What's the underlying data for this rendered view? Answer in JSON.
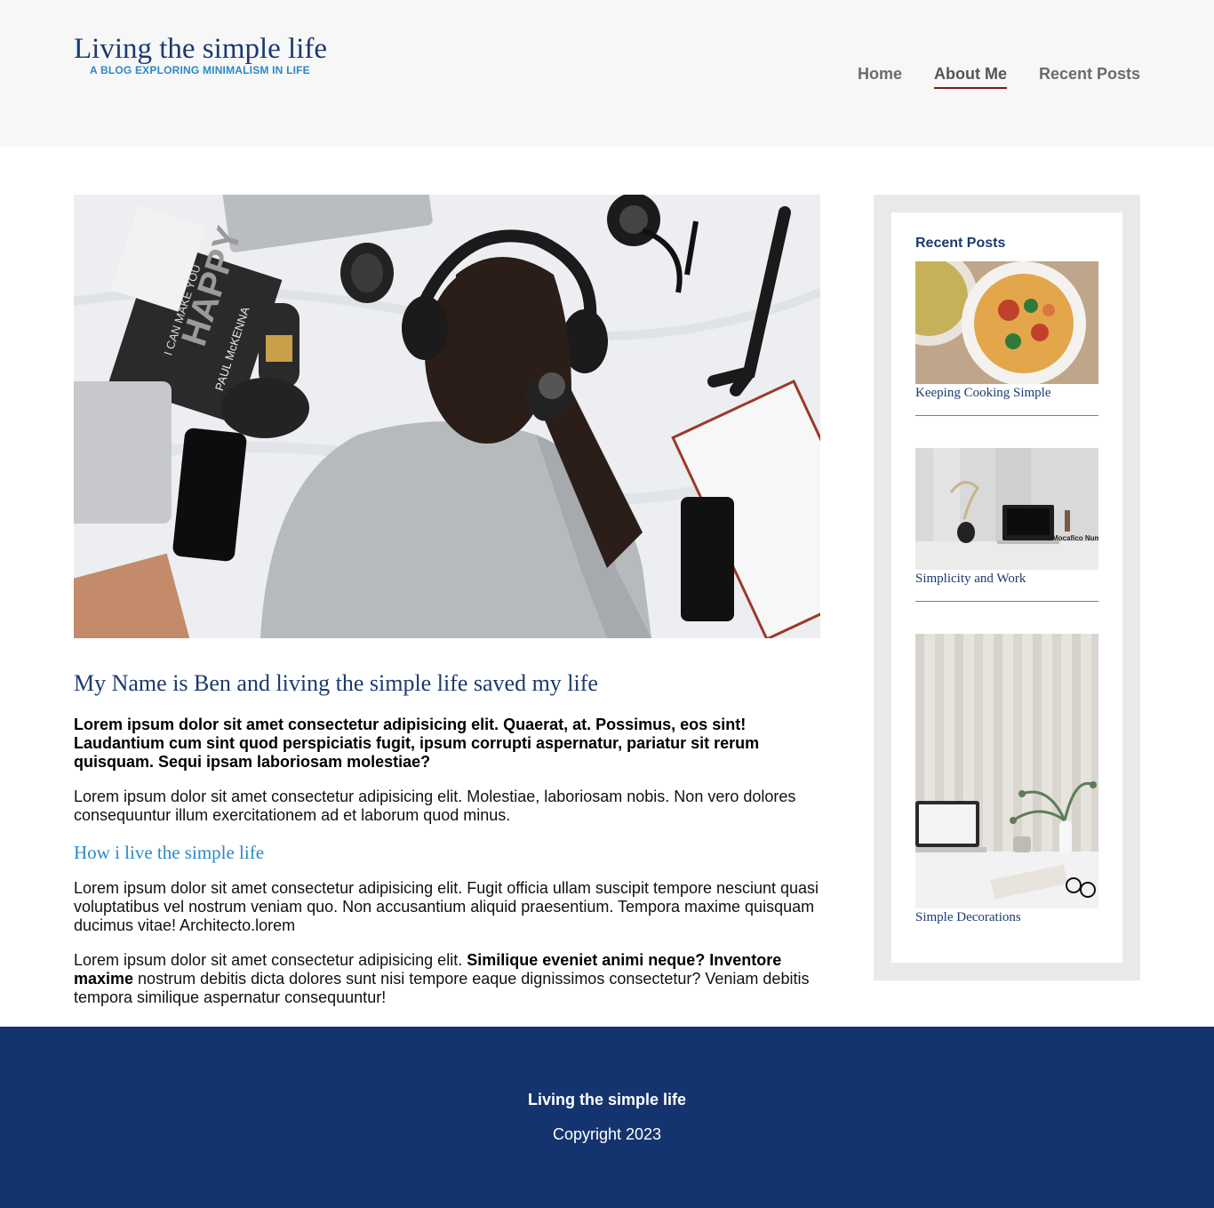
{
  "header": {
    "site_title": "Living the simple life",
    "tagline": "A BLOG EXPLORING MINIMALISM IN LIFE",
    "nav": [
      {
        "label": "Home",
        "active": false
      },
      {
        "label": "About Me",
        "active": true
      },
      {
        "label": "Recent Posts",
        "active": false
      }
    ]
  },
  "article": {
    "hero_image_text": {
      "book_line_1": "I CAN MAKE YOU",
      "book_line_2": "HAPPY",
      "book_author": "PAUL McKENNA"
    },
    "title": "My Name is Ben and living the simple life saved my life",
    "lead": "Lorem ipsum dolor sit amet consectetur adipisicing elit. Quaerat, at. Possimus, eos sint! Laudantium cum sint quod perspiciatis fugit, ipsum corrupti aspernatur, pariatur sit rerum quisquam. Sequi ipsam laboriosam molestiae?",
    "paragraph_1": "Lorem ipsum dolor sit amet consectetur adipisicing elit. Molestiae, laboriosam nobis. Non vero dolores consequuntur illum exercitationem ad et laborum quod minus.",
    "subheading": "How i live the simple life",
    "paragraph_2": "Lorem ipsum dolor sit amet consectetur adipisicing elit. Fugit officia ullam suscipit tempore nesciunt quasi voluptatibus vel nostrum veniam quo. Non accusantium aliquid praesentium. Tempora maxime quisquam ducimus vitae! Architecto.lorem",
    "paragraph_3_start": "Lorem ipsum dolor sit amet consectetur adipisicing elit. ",
    "paragraph_3_bold": "Similique eveniet animi neque? Inventore maxime",
    "paragraph_3_end": " nostrum debitis dicta dolores sunt nisi tempore eaque dignissimos consectetur? Veniam debitis tempora similique aspernatur consequuntur!"
  },
  "sidebar": {
    "title": "Recent Posts",
    "posts": [
      {
        "title": "Keeping Cooking Simple"
      },
      {
        "title": "Simplicity and Work",
        "image_text": "Mocafico Numero"
      },
      {
        "title": "Simple Decorations"
      }
    ]
  },
  "footer": {
    "title": "Living the simple life",
    "copyright": "Copyright 2023"
  },
  "colors": {
    "brand_navy": "#1c3a6e",
    "accent_blue": "#2a8ac8",
    "nav_active_underline": "#7a1a1a",
    "footer_bg": "#143470",
    "header_bg": "#f7f7f7"
  }
}
